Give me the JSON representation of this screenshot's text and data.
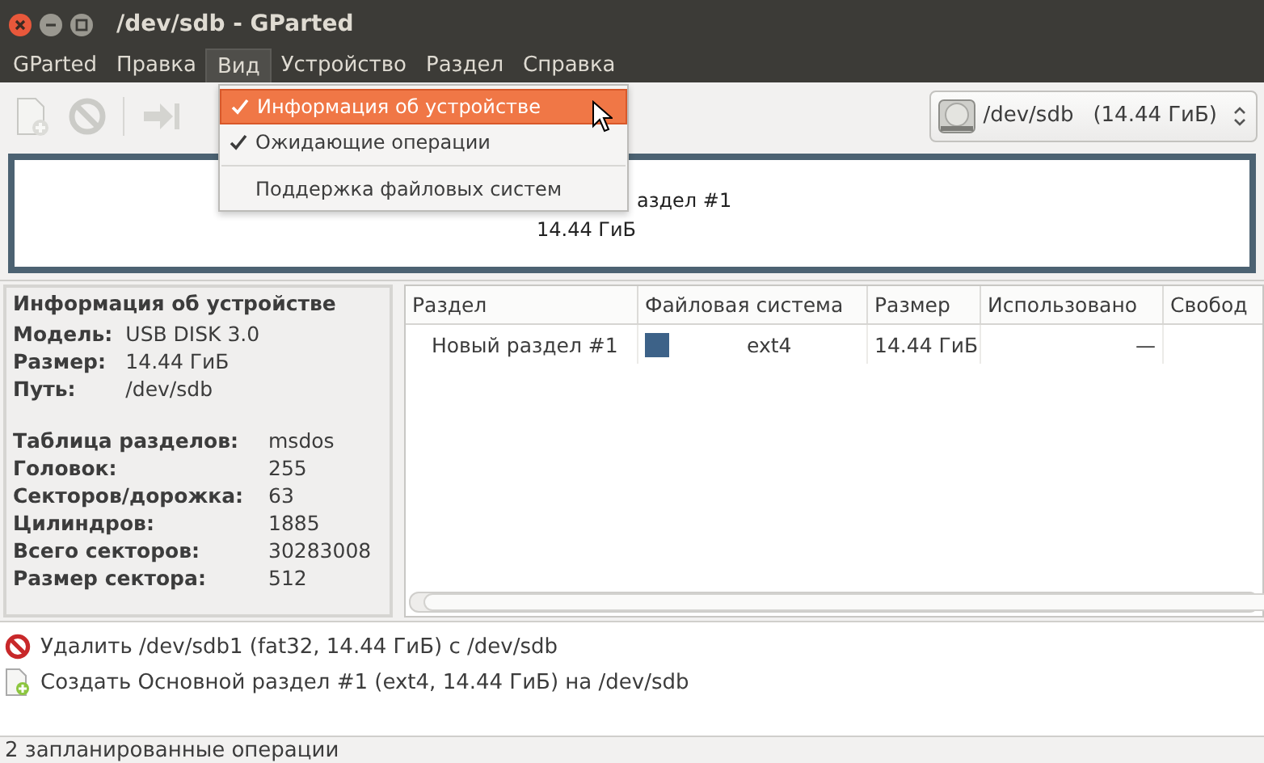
{
  "window": {
    "title": "/dev/sdb - GParted"
  },
  "menubar": [
    {
      "label": "GParted",
      "selected": false
    },
    {
      "label": "Правка",
      "selected": false
    },
    {
      "label": "Вид",
      "selected": true
    },
    {
      "label": "Устройство",
      "selected": false
    },
    {
      "label": "Раздел",
      "selected": false
    },
    {
      "label": "Справка",
      "selected": false
    }
  ],
  "view_menu": [
    {
      "label": "Информация об устройстве",
      "checked": true,
      "selected": true
    },
    {
      "label": "Ожидающие операции",
      "checked": true,
      "selected": false
    },
    {
      "label": "Поддержка файловых систем",
      "checked": false,
      "selected": false
    }
  ],
  "device_selector": {
    "value": "/dev/sdb",
    "size": "(14.44 ГиБ)"
  },
  "disk_map": {
    "label": "аздел #1",
    "size": "14.44 ГиБ"
  },
  "device_info": {
    "title": "Информация об устройстве",
    "fields": [
      {
        "label": "Модель:",
        "value": "USB DISK 3.0"
      },
      {
        "label": "Размер:",
        "value": "14.44 ГиБ"
      },
      {
        "label": "Путь:",
        "value": "/dev/sdb"
      }
    ],
    "details": [
      {
        "label": "Таблица разделов:",
        "value": "msdos"
      },
      {
        "label": "Головок:",
        "value": "255"
      },
      {
        "label": "Секторов/дорожка:",
        "value": "63"
      },
      {
        "label": "Цилиндров:",
        "value": "1885"
      },
      {
        "label": "Всего секторов:",
        "value": "30283008"
      },
      {
        "label": "Размер сектора:",
        "value": "512"
      }
    ]
  },
  "table": {
    "columns": [
      "Раздел",
      "Файловая система",
      "Размер",
      "Использовано",
      "Свобод"
    ],
    "rows": [
      {
        "partition": "Новый раздел #1",
        "color": "#3d6288",
        "filesystem": "ext4",
        "size": "14.44 ГиБ",
        "used": "—"
      }
    ]
  },
  "operations": [
    {
      "kind": "delete",
      "text": "Удалить /dev/sdb1 (fat32, 14.44 ГиБ) с /dev/sdb"
    },
    {
      "kind": "create",
      "text": "Создать Основной раздел #1 (ext4, 14.44 ГиБ) на /dev/sdb"
    }
  ],
  "status_bar": "2 запланированные операции"
}
